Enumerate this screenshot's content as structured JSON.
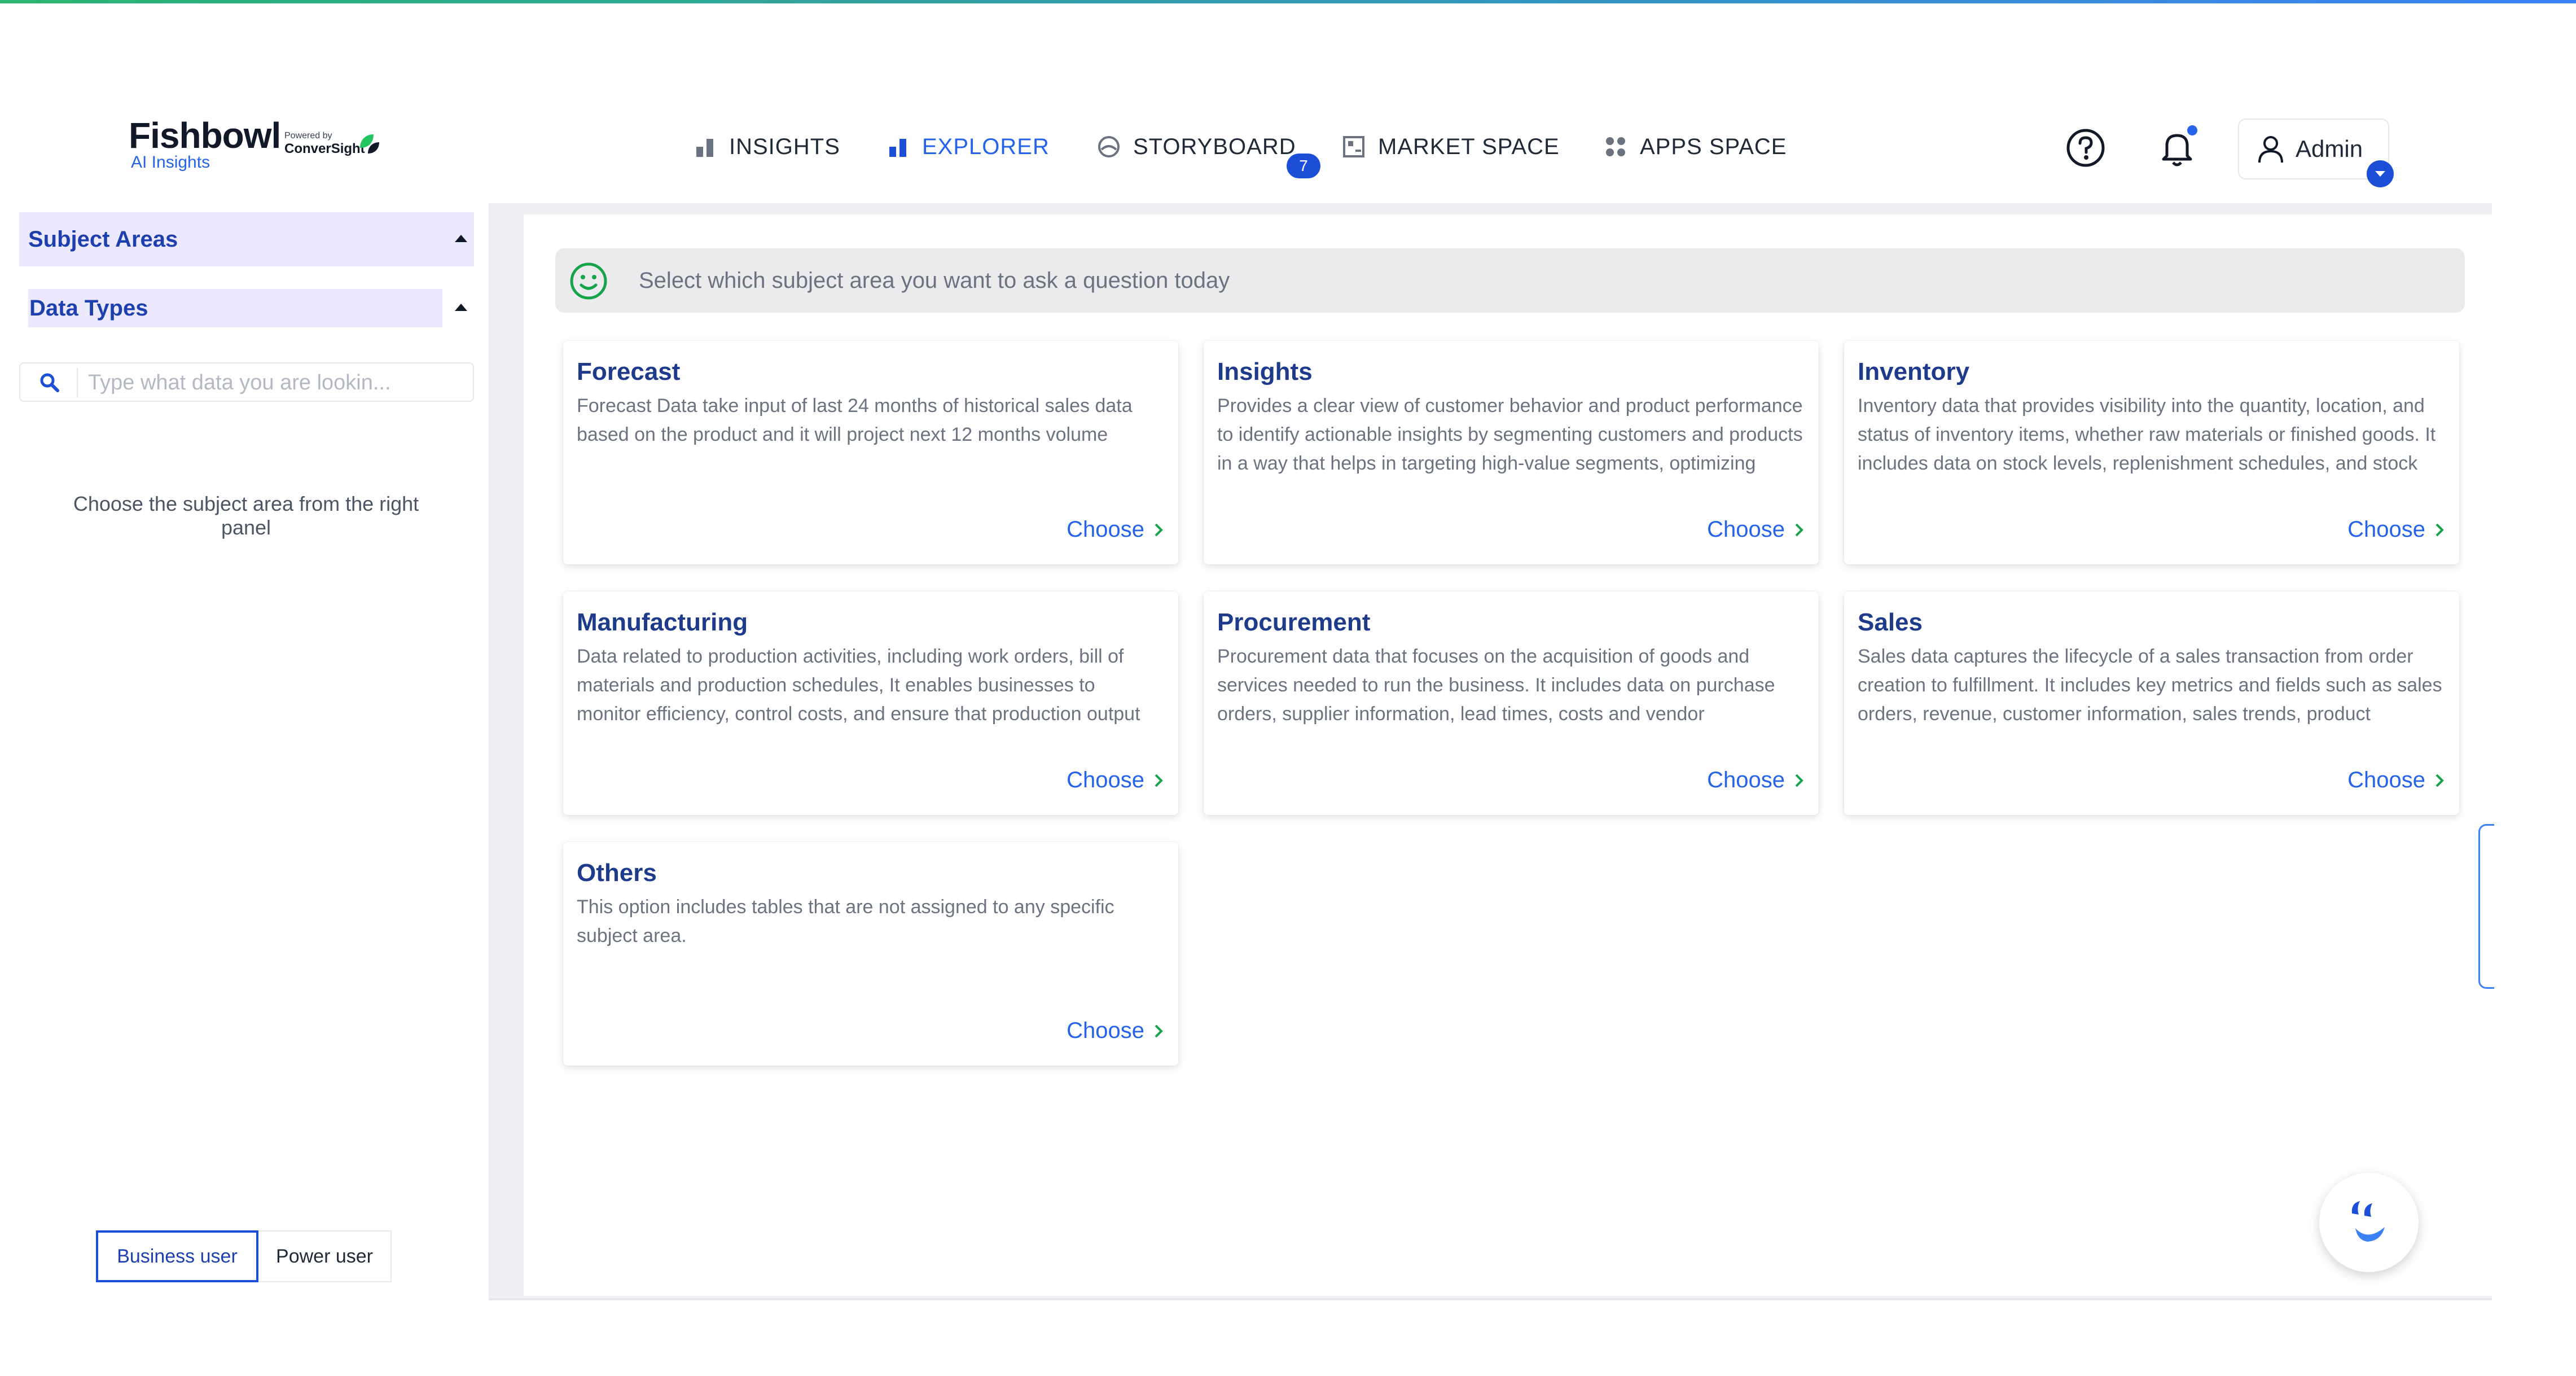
{
  "header": {
    "logo": {
      "name": "Fishbowl",
      "sub": "AI Insights",
      "powered_by": "Powered by",
      "powered_brand": "ConverSight"
    },
    "nav": [
      {
        "label": "INSIGHTS",
        "icon": "bar-chart-icon",
        "active": false
      },
      {
        "label": "EXPLORER",
        "icon": "bar-chart-icon",
        "active": true
      },
      {
        "label": "STORYBOARD",
        "icon": "storyboard-icon",
        "active": false,
        "badge": "7"
      },
      {
        "label": "MARKET SPACE",
        "icon": "market-icon",
        "active": false
      },
      {
        "label": "APPS SPACE",
        "icon": "grid-icon",
        "active": false
      }
    ],
    "user": {
      "label": "Admin"
    }
  },
  "sidebar": {
    "subject_areas_label": "Subject Areas",
    "data_types_label": "Data Types",
    "search_placeholder": "Type what data you are lookin...",
    "empty_message": "Choose the subject area from the right panel",
    "user_modes": {
      "business": "Business user",
      "power": "Power user",
      "selected": "business"
    }
  },
  "main": {
    "prompt": "Select which subject area you want to ask a question today",
    "choose_label": "Choose",
    "cards": [
      {
        "title": "Forecast",
        "description": "Forecast Data take input of last 24 months of historical sales data based on the product and it will project next 12 months volume"
      },
      {
        "title": "Insights",
        "description": "Provides a clear view of customer behavior and product performance to identify actionable insights by segmenting customers and products in a way that helps in targeting high-value segments, optimizing inventory, and enhancing"
      },
      {
        "title": "Inventory",
        "description": "Inventory data that provides visibility into the quantity, location, and status of inventory items, whether raw materials or finished goods. It includes data on stock levels, replenishment schedules, and stock valuation. Managing"
      },
      {
        "title": "Manufacturing",
        "description": "Data related to production activities, including work orders, bill of materials and production schedules, It enables businesses to monitor efficiency, control costs, and ensure that production output meets demand in terms of quality"
      },
      {
        "title": "Procurement",
        "description": "Procurement data that focuses on the acquisition of goods and services needed to run the business. It includes data on purchase orders, supplier information, lead times, costs and vendor performance. This area is key to monitoring costs."
      },
      {
        "title": "Sales",
        "description": "Sales data captures the lifecycle of a sales transaction from order creation to fulfillment. It includes key metrics and fields such as sales orders, revenue, customer information, sales trends, product performance, and payment terms. This"
      },
      {
        "title": "Others",
        "description": "This option includes tables that are not assigned to any specific subject area."
      }
    ]
  },
  "colors": {
    "accent": "#2563eb",
    "title": "#1e3a8a",
    "panel": "#eeeff2",
    "highlight": "#ece9fe"
  }
}
